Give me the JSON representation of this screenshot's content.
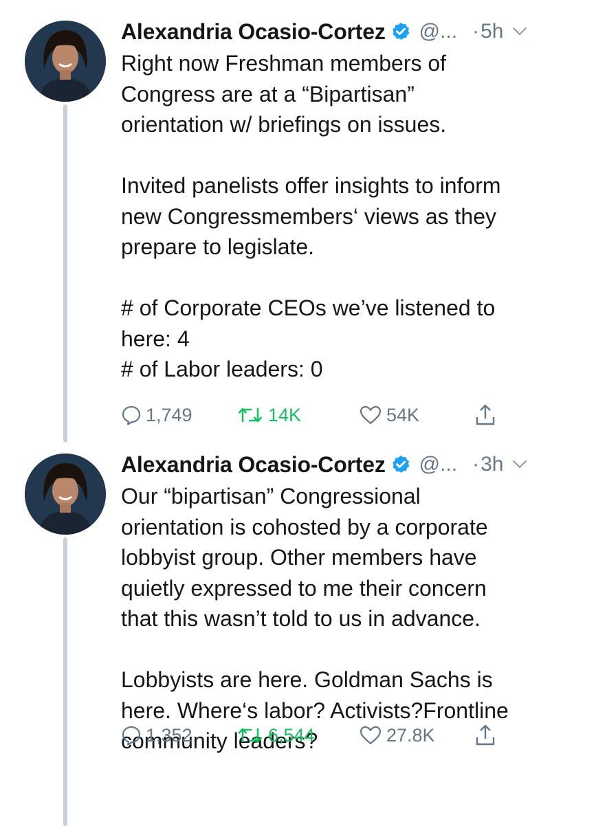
{
  "tweets": [
    {
      "author": {
        "name": "Alexandria Ocasio-Cortez",
        "handle": "@...",
        "verified": true
      },
      "separator": "·",
      "time": "5h",
      "paragraphs": [
        [
          "Right now Freshman members of",
          "Congress are at a “Bipartisan”",
          "orientation w/ briefings on issues."
        ],
        [
          "Invited panelists offer insights to inform",
          "new Congressmembers‘ views as they",
          "prepare to legislate."
        ],
        [
          "# of Corporate CEOs we’ve listened to",
          "here: 4",
          "# of Labor leaders: 0"
        ]
      ],
      "actions": {
        "replies": "1,749",
        "retweets": "14K",
        "likes": "54K"
      }
    },
    {
      "author": {
        "name": "Alexandria Ocasio-Cortez",
        "handle": "@...",
        "verified": true
      },
      "separator": "·",
      "time": "3h",
      "paragraphs": [
        [
          "Our “bipartisan” Congressional",
          "orientation is cohosted by a corporate",
          "lobbyist group. Other members have",
          "quietly expressed to me their concern",
          "that this wasn’t told to us in advance."
        ],
        [
          "Lobbyists are here. Goldman Sachs is",
          "here. Where‘s labor? Activists?Frontline",
          "community leaders?"
        ]
      ],
      "actions": {
        "replies": "1,352",
        "retweets": "6,544",
        "likes": "27.8K"
      }
    }
  ],
  "colors": {
    "text": "#14171a",
    "secondary": "#657786",
    "retweet_active": "#17bf63",
    "verified": "#1da1f2",
    "thread_line": "#c9d1d8"
  },
  "icons": {
    "reply": "reply-icon",
    "retweet": "retweet-icon",
    "like": "heart-icon",
    "share": "share-icon",
    "verified": "verified-badge-icon",
    "menu": "chevron-down-icon"
  }
}
